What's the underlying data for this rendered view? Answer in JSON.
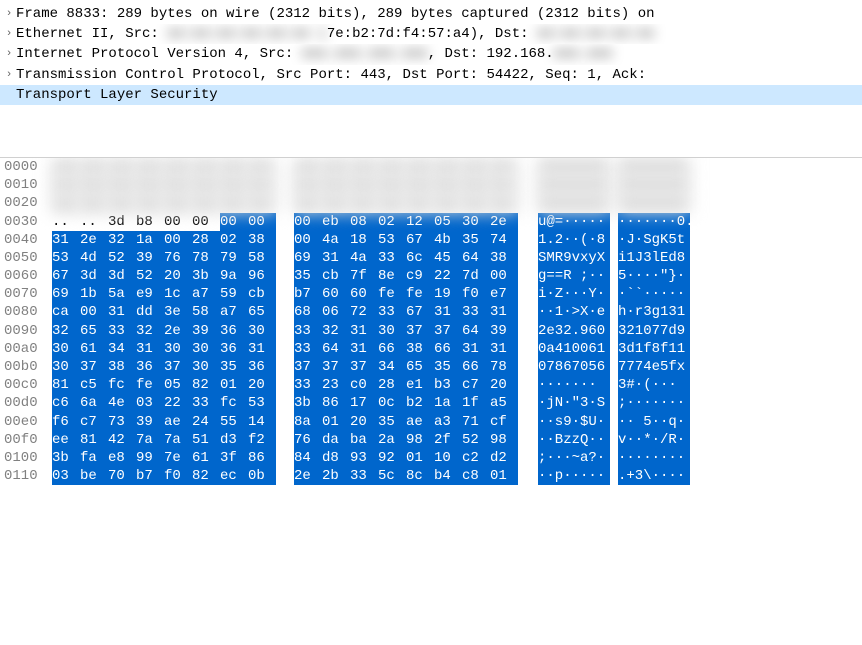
{
  "tree": {
    "rows": [
      {
        "arrow": "›",
        "pre": "Frame 8833: 289 bytes on wire (2312 bits), 289 bytes captured (2312 bits) on",
        "mid": "",
        "post": "",
        "selected": false,
        "blur_mid": false
      },
      {
        "arrow": "›",
        "pre": "Ethernet II, Src: ",
        "mid": "xx:xx:xx:xx:xx:xx (",
        "post": "7e:b2:7d:f4:57:a4), Dst: ",
        "trail_blur": "xx:xx:xx:xx:xx",
        "selected": false,
        "blur_mid": true
      },
      {
        "arrow": "›",
        "pre": "Internet Protocol Version 4, Src: ",
        "mid": "xxx.xxx.xxx.xxx",
        "post": ", Dst: 192.168.",
        "trail_blur": "xxx.xxx",
        "selected": false,
        "blur_mid": true
      },
      {
        "arrow": "›",
        "pre": "Transmission Control Protocol, Src Port: 443, Dst Port: 54422, Seq: 1, Ack:",
        "mid": "",
        "post": "",
        "selected": false,
        "blur_mid": false
      },
      {
        "arrow": "",
        "pre": "Transport Layer Security",
        "mid": "",
        "post": "",
        "selected": true,
        "blur_mid": false
      }
    ]
  },
  "hex": {
    "rows": [
      {
        "offset": "0000",
        "b": [
          "..",
          "..",
          "..",
          "..",
          "..",
          "..",
          "..",
          "..",
          "..",
          "..",
          "..",
          "..",
          "..",
          "..",
          "..",
          ".."
        ],
        "a": [
          "········",
          "········"
        ],
        "hl_from": 99,
        "blur": true
      },
      {
        "offset": "0010",
        "b": [
          "..",
          "..",
          "..",
          "..",
          "..",
          "..",
          "..",
          "..",
          "..",
          "..",
          "..",
          "..",
          "..",
          "..",
          "..",
          ".."
        ],
        "a": [
          "········",
          "········"
        ],
        "hl_from": 99,
        "blur": true
      },
      {
        "offset": "0020",
        "b": [
          "..",
          "..",
          "..",
          "..",
          "..",
          "..",
          "..",
          "..",
          "..",
          "..",
          "..",
          "..",
          "..",
          "..",
          "..",
          ".."
        ],
        "a": [
          "········",
          "········"
        ],
        "hl_from": 99,
        "blur": true
      },
      {
        "offset": "0030",
        "b": [
          "..",
          "..",
          "3d",
          "b8",
          "00",
          "00",
          "00",
          "00",
          "00",
          "eb",
          "08",
          "02",
          "12",
          "05",
          "30",
          "2e"
        ],
        "a": [
          "u@=·····",
          "·······0."
        ],
        "hl_from": 6,
        "blur": false
      },
      {
        "offset": "0040",
        "b": [
          "31",
          "2e",
          "32",
          "1a",
          "00",
          "28",
          "02",
          "38",
          "00",
          "4a",
          "18",
          "53",
          "67",
          "4b",
          "35",
          "74"
        ],
        "a": [
          "1.2··(·8",
          "·J·SgK5t"
        ],
        "hl_from": 0,
        "blur": false
      },
      {
        "offset": "0050",
        "b": [
          "53",
          "4d",
          "52",
          "39",
          "76",
          "78",
          "79",
          "58",
          "69",
          "31",
          "4a",
          "33",
          "6c",
          "45",
          "64",
          "38"
        ],
        "a": [
          "SMR9vxyX",
          "i1J3lEd8"
        ],
        "hl_from": 0,
        "blur": false
      },
      {
        "offset": "0060",
        "b": [
          "67",
          "3d",
          "3d",
          "52",
          "20",
          "3b",
          "9a",
          "96",
          "35",
          "cb",
          "7f",
          "8e",
          "c9",
          "22",
          "7d",
          "00"
        ],
        "a": [
          "g==R ;··",
          "5····\"}·"
        ],
        "hl_from": 0,
        "blur": false
      },
      {
        "offset": "0070",
        "b": [
          "69",
          "1b",
          "5a",
          "e9",
          "1c",
          "a7",
          "59",
          "cb",
          "b7",
          "60",
          "60",
          "fe",
          "fe",
          "19",
          "f0",
          "e7"
        ],
        "a": [
          "i·Z···Y·",
          "·``·····"
        ],
        "hl_from": 0,
        "blur": false
      },
      {
        "offset": "0080",
        "b": [
          "ca",
          "00",
          "31",
          "dd",
          "3e",
          "58",
          "a7",
          "65",
          "68",
          "06",
          "72",
          "33",
          "67",
          "31",
          "33",
          "31"
        ],
        "a": [
          "··1·>X·e",
          "h·r3g131"
        ],
        "hl_from": 0,
        "blur": false
      },
      {
        "offset": "0090",
        "b": [
          "32",
          "65",
          "33",
          "32",
          "2e",
          "39",
          "36",
          "30",
          "33",
          "32",
          "31",
          "30",
          "37",
          "37",
          "64",
          "39"
        ],
        "a": [
          "2e32.960",
          "321077d9"
        ],
        "hl_from": 0,
        "blur": false
      },
      {
        "offset": "00a0",
        "b": [
          "30",
          "61",
          "34",
          "31",
          "30",
          "30",
          "36",
          "31",
          "33",
          "64",
          "31",
          "66",
          "38",
          "66",
          "31",
          "31"
        ],
        "a": [
          "0a410061",
          "3d1f8f11"
        ],
        "hl_from": 0,
        "blur": false
      },
      {
        "offset": "00b0",
        "b": [
          "30",
          "37",
          "38",
          "36",
          "37",
          "30",
          "35",
          "36",
          "37",
          "37",
          "37",
          "34",
          "65",
          "35",
          "66",
          "78"
        ],
        "a": [
          "07867056",
          "7774e5fx"
        ],
        "hl_from": 0,
        "blur": false
      },
      {
        "offset": "00c0",
        "b": [
          "81",
          "c5",
          "fc",
          "fe",
          "05",
          "82",
          "01",
          "20",
          "33",
          "23",
          "c0",
          "28",
          "e1",
          "b3",
          "c7",
          "20"
        ],
        "a": [
          "······· ",
          "3#·(··· "
        ],
        "hl_from": 0,
        "blur": false
      },
      {
        "offset": "00d0",
        "b": [
          "c6",
          "6a",
          "4e",
          "03",
          "22",
          "33",
          "fc",
          "53",
          "3b",
          "86",
          "17",
          "0c",
          "b2",
          "1a",
          "1f",
          "a5"
        ],
        "a": [
          "·jN·\"3·S",
          ";·······"
        ],
        "hl_from": 0,
        "blur": false
      },
      {
        "offset": "00e0",
        "b": [
          "f6",
          "c7",
          "73",
          "39",
          "ae",
          "24",
          "55",
          "14",
          "8a",
          "01",
          "20",
          "35",
          "ae",
          "a3",
          "71",
          "cf"
        ],
        "a": [
          "··s9·$U·",
          "·· 5··q·"
        ],
        "hl_from": 0,
        "blur": false
      },
      {
        "offset": "00f0",
        "b": [
          "ee",
          "81",
          "42",
          "7a",
          "7a",
          "51",
          "d3",
          "f2",
          "76",
          "da",
          "ba",
          "2a",
          "98",
          "2f",
          "52",
          "98"
        ],
        "a": [
          "··BzzQ··",
          "v··*·/R·"
        ],
        "hl_from": 0,
        "blur": false
      },
      {
        "offset": "0100",
        "b": [
          "3b",
          "fa",
          "e8",
          "99",
          "7e",
          "61",
          "3f",
          "86",
          "84",
          "d8",
          "93",
          "92",
          "01",
          "10",
          "c2",
          "d2"
        ],
        "a": [
          ";···~a?·",
          "········"
        ],
        "hl_from": 0,
        "blur": false
      },
      {
        "offset": "0110",
        "b": [
          "03",
          "be",
          "70",
          "b7",
          "f0",
          "82",
          "ec",
          "0b",
          "2e",
          "2b",
          "33",
          "5c",
          "8c",
          "b4",
          "c8",
          "01"
        ],
        "a": [
          "··p·····",
          ".+3\\····"
        ],
        "hl_from": 0,
        "blur": false
      }
    ]
  }
}
